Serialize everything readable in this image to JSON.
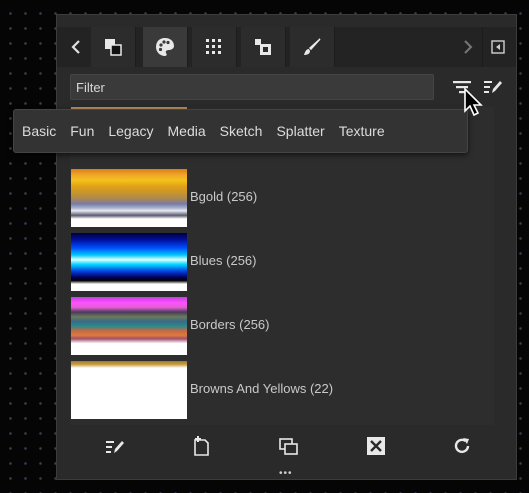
{
  "tabs": [
    {
      "icon": "color-swatch-icon",
      "active": false
    },
    {
      "icon": "palette-icon",
      "active": true
    },
    {
      "icon": "grid-dots-icon",
      "active": false
    },
    {
      "icon": "layers-icon",
      "active": false
    },
    {
      "icon": "brush-icon",
      "active": false
    }
  ],
  "filter": {
    "placeholder": "Filter"
  },
  "palettes": [
    {
      "label": ""
    },
    {
      "label": "Bgold (256)"
    },
    {
      "label": "Blues (256)"
    },
    {
      "label": "Borders (256)"
    },
    {
      "label": "Browns And Yellows (22)"
    }
  ],
  "categories": [
    "Basic",
    "Fun",
    "Legacy",
    "Media",
    "Sketch",
    "Splatter",
    "Texture"
  ],
  "bottom_icons": [
    "edit-icon",
    "new-palette-icon",
    "duplicate-icon",
    "delete-icon",
    "refresh-icon"
  ],
  "colors": {
    "panel": "#2a2a2a",
    "tab_active": "#3a3a3a",
    "text": "#c9c9c9"
  }
}
